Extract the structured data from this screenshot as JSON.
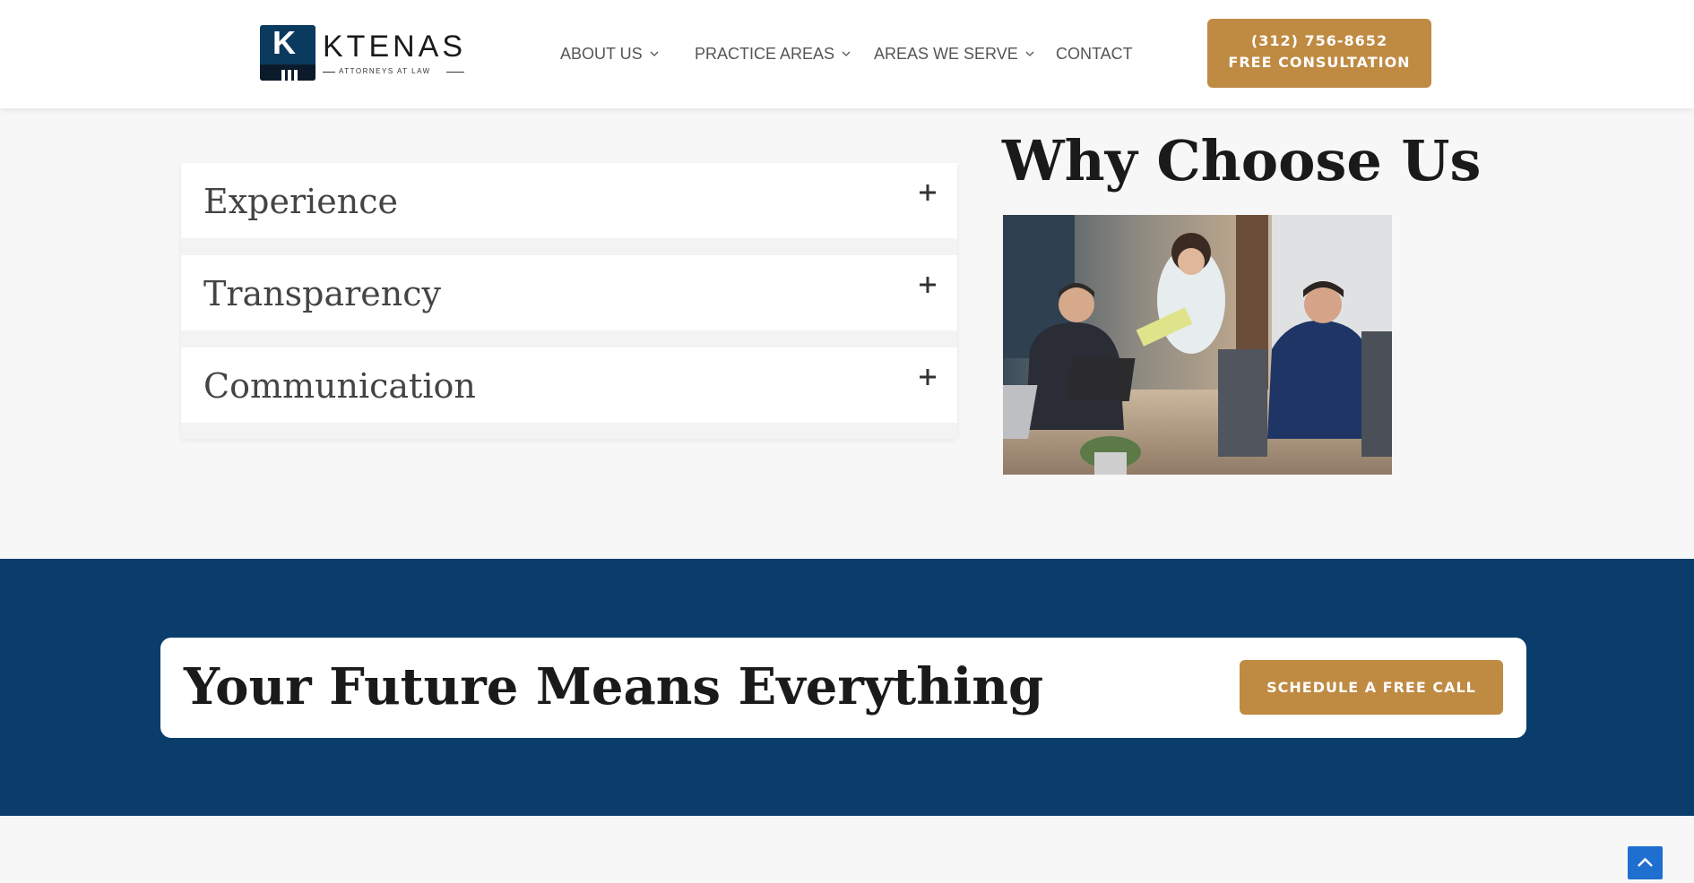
{
  "brand": {
    "name": "KTENAS",
    "tagline": "ATTORNEYS AT LAW",
    "logo_letter": "K",
    "colors": {
      "navy": "#0b3a5f",
      "gold": "#bf8a42",
      "banner_blue": "#0a3d6b"
    }
  },
  "nav": {
    "items": [
      {
        "label": "ABOUT US",
        "has_dropdown": true
      },
      {
        "label": "PRACTICE AREAS",
        "has_dropdown": true
      },
      {
        "label": "AREAS WE SERVE",
        "has_dropdown": true
      },
      {
        "label": "CONTACT",
        "has_dropdown": false
      }
    ]
  },
  "cta": {
    "phone": "(312) 756-8652",
    "label": "FREE CONSULTATION"
  },
  "accordion": {
    "items": [
      {
        "title": "Experience",
        "icon": "plus-icon"
      },
      {
        "title": "Transparency",
        "icon": "plus-icon"
      },
      {
        "title": "Communication",
        "icon": "plus-icon"
      }
    ]
  },
  "why": {
    "title": "Why Choose Us"
  },
  "banner": {
    "title": "Your Future Means Everything",
    "button_label": "SCHEDULE A FREE CALL"
  },
  "scroll_top": {
    "icon": "chevron-up-icon"
  }
}
